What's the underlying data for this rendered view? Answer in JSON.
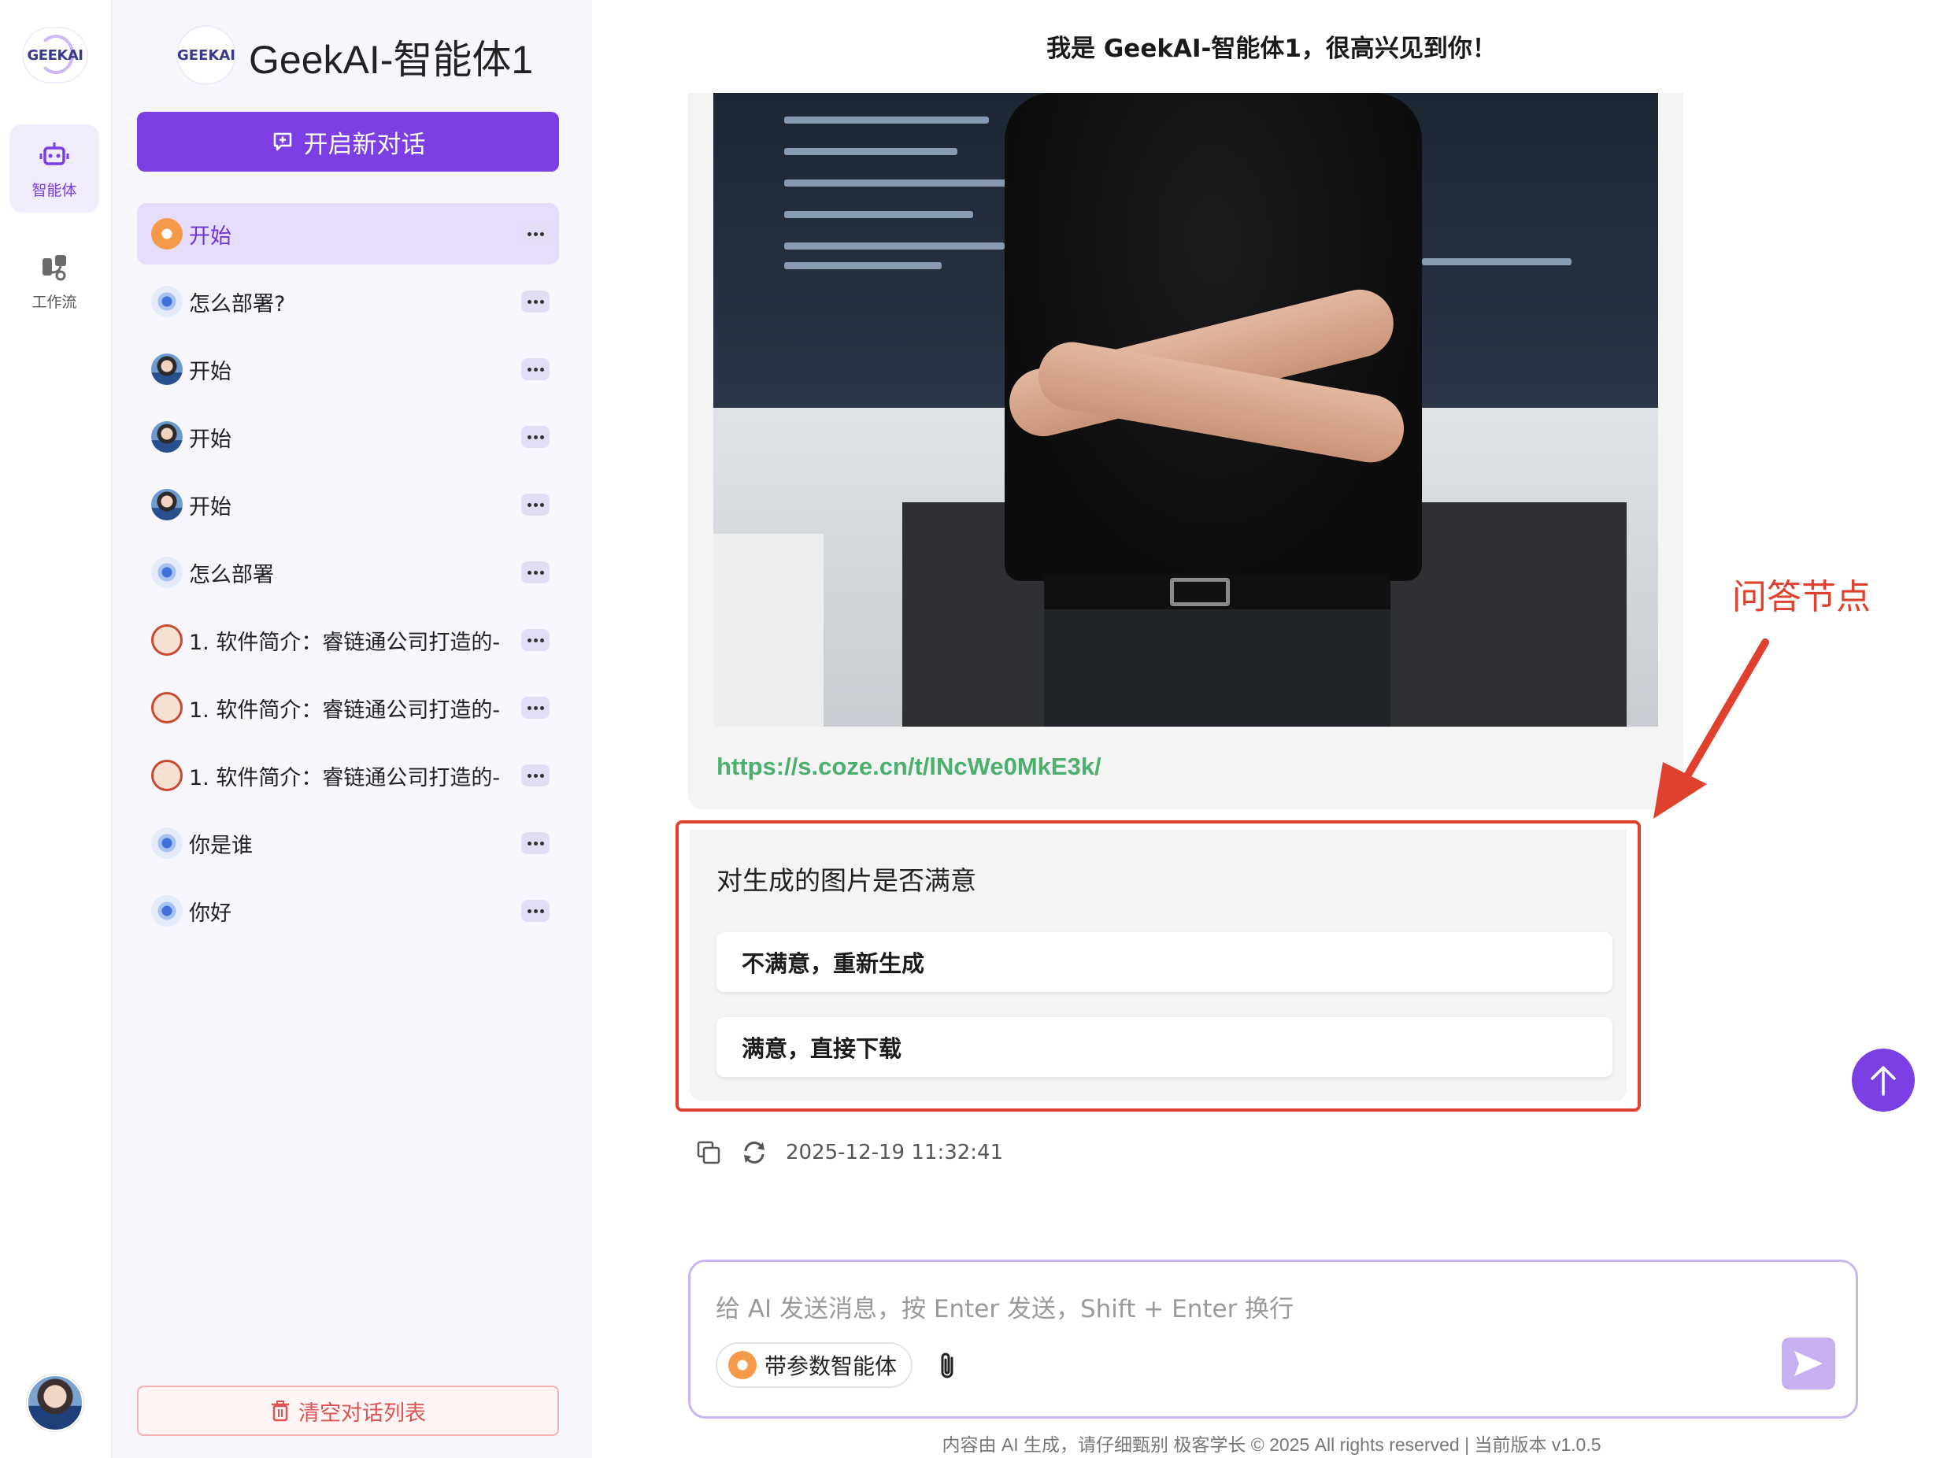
{
  "rail": {
    "logo_text": "GEEKAI",
    "items": [
      {
        "label": "智能体",
        "icon": "robot-icon",
        "active": true
      },
      {
        "label": "工作流",
        "icon": "workflow-icon",
        "active": false
      }
    ]
  },
  "sidebar": {
    "logo_text": "GEEKAI",
    "title": "GeekAI-智能体1",
    "new_chat_label": "开启新对话",
    "conversations": [
      {
        "label": "开始",
        "avatar": "orange-puzzle"
      },
      {
        "label": "怎么部署?",
        "avatar": "blue-bot"
      },
      {
        "label": "开始",
        "avatar": "person"
      },
      {
        "label": "开始",
        "avatar": "person"
      },
      {
        "label": "开始",
        "avatar": "person"
      },
      {
        "label": "怎么部署",
        "avatar": "blue-bot"
      },
      {
        "label": "1. 软件简介：睿链通公司打造的-",
        "avatar": "seal"
      },
      {
        "label": "1. 软件简介：睿链通公司打造的-",
        "avatar": "seal"
      },
      {
        "label": "1. 软件简介：睿链通公司打造的-",
        "avatar": "seal"
      },
      {
        "label": "你是谁",
        "avatar": "blue-bot"
      },
      {
        "label": "你好",
        "avatar": "blue-bot"
      }
    ],
    "clear_label": "清空对话列表"
  },
  "main": {
    "header": "我是 GeekAI-智能体1，很高兴见到你！",
    "image_alt": "Man in black t-shirt with crossed arms in front of code screen",
    "link": "https://s.coze.cn/t/lNcWe0MkE3k/",
    "question": "对生成的图片是否满意",
    "options": [
      "不满意，重新生成",
      "满意，直接下载"
    ],
    "timestamp": "2025-12-19 11:32:41"
  },
  "annotation": {
    "label": "问答节点",
    "color": "#e0412e"
  },
  "composer": {
    "placeholder": "给 AI 发送消息，按 Enter 发送，Shift + Enter 换行",
    "agent_chip": "带参数智能体"
  },
  "footer": "内容由 AI 生成，请仔细甄别 极客学长 © 2025 All rights reserved | 当前版本 v1.0.5",
  "colors": {
    "accent": "#7b3fe4",
    "link": "#4caf6e",
    "danger": "#e05252"
  }
}
